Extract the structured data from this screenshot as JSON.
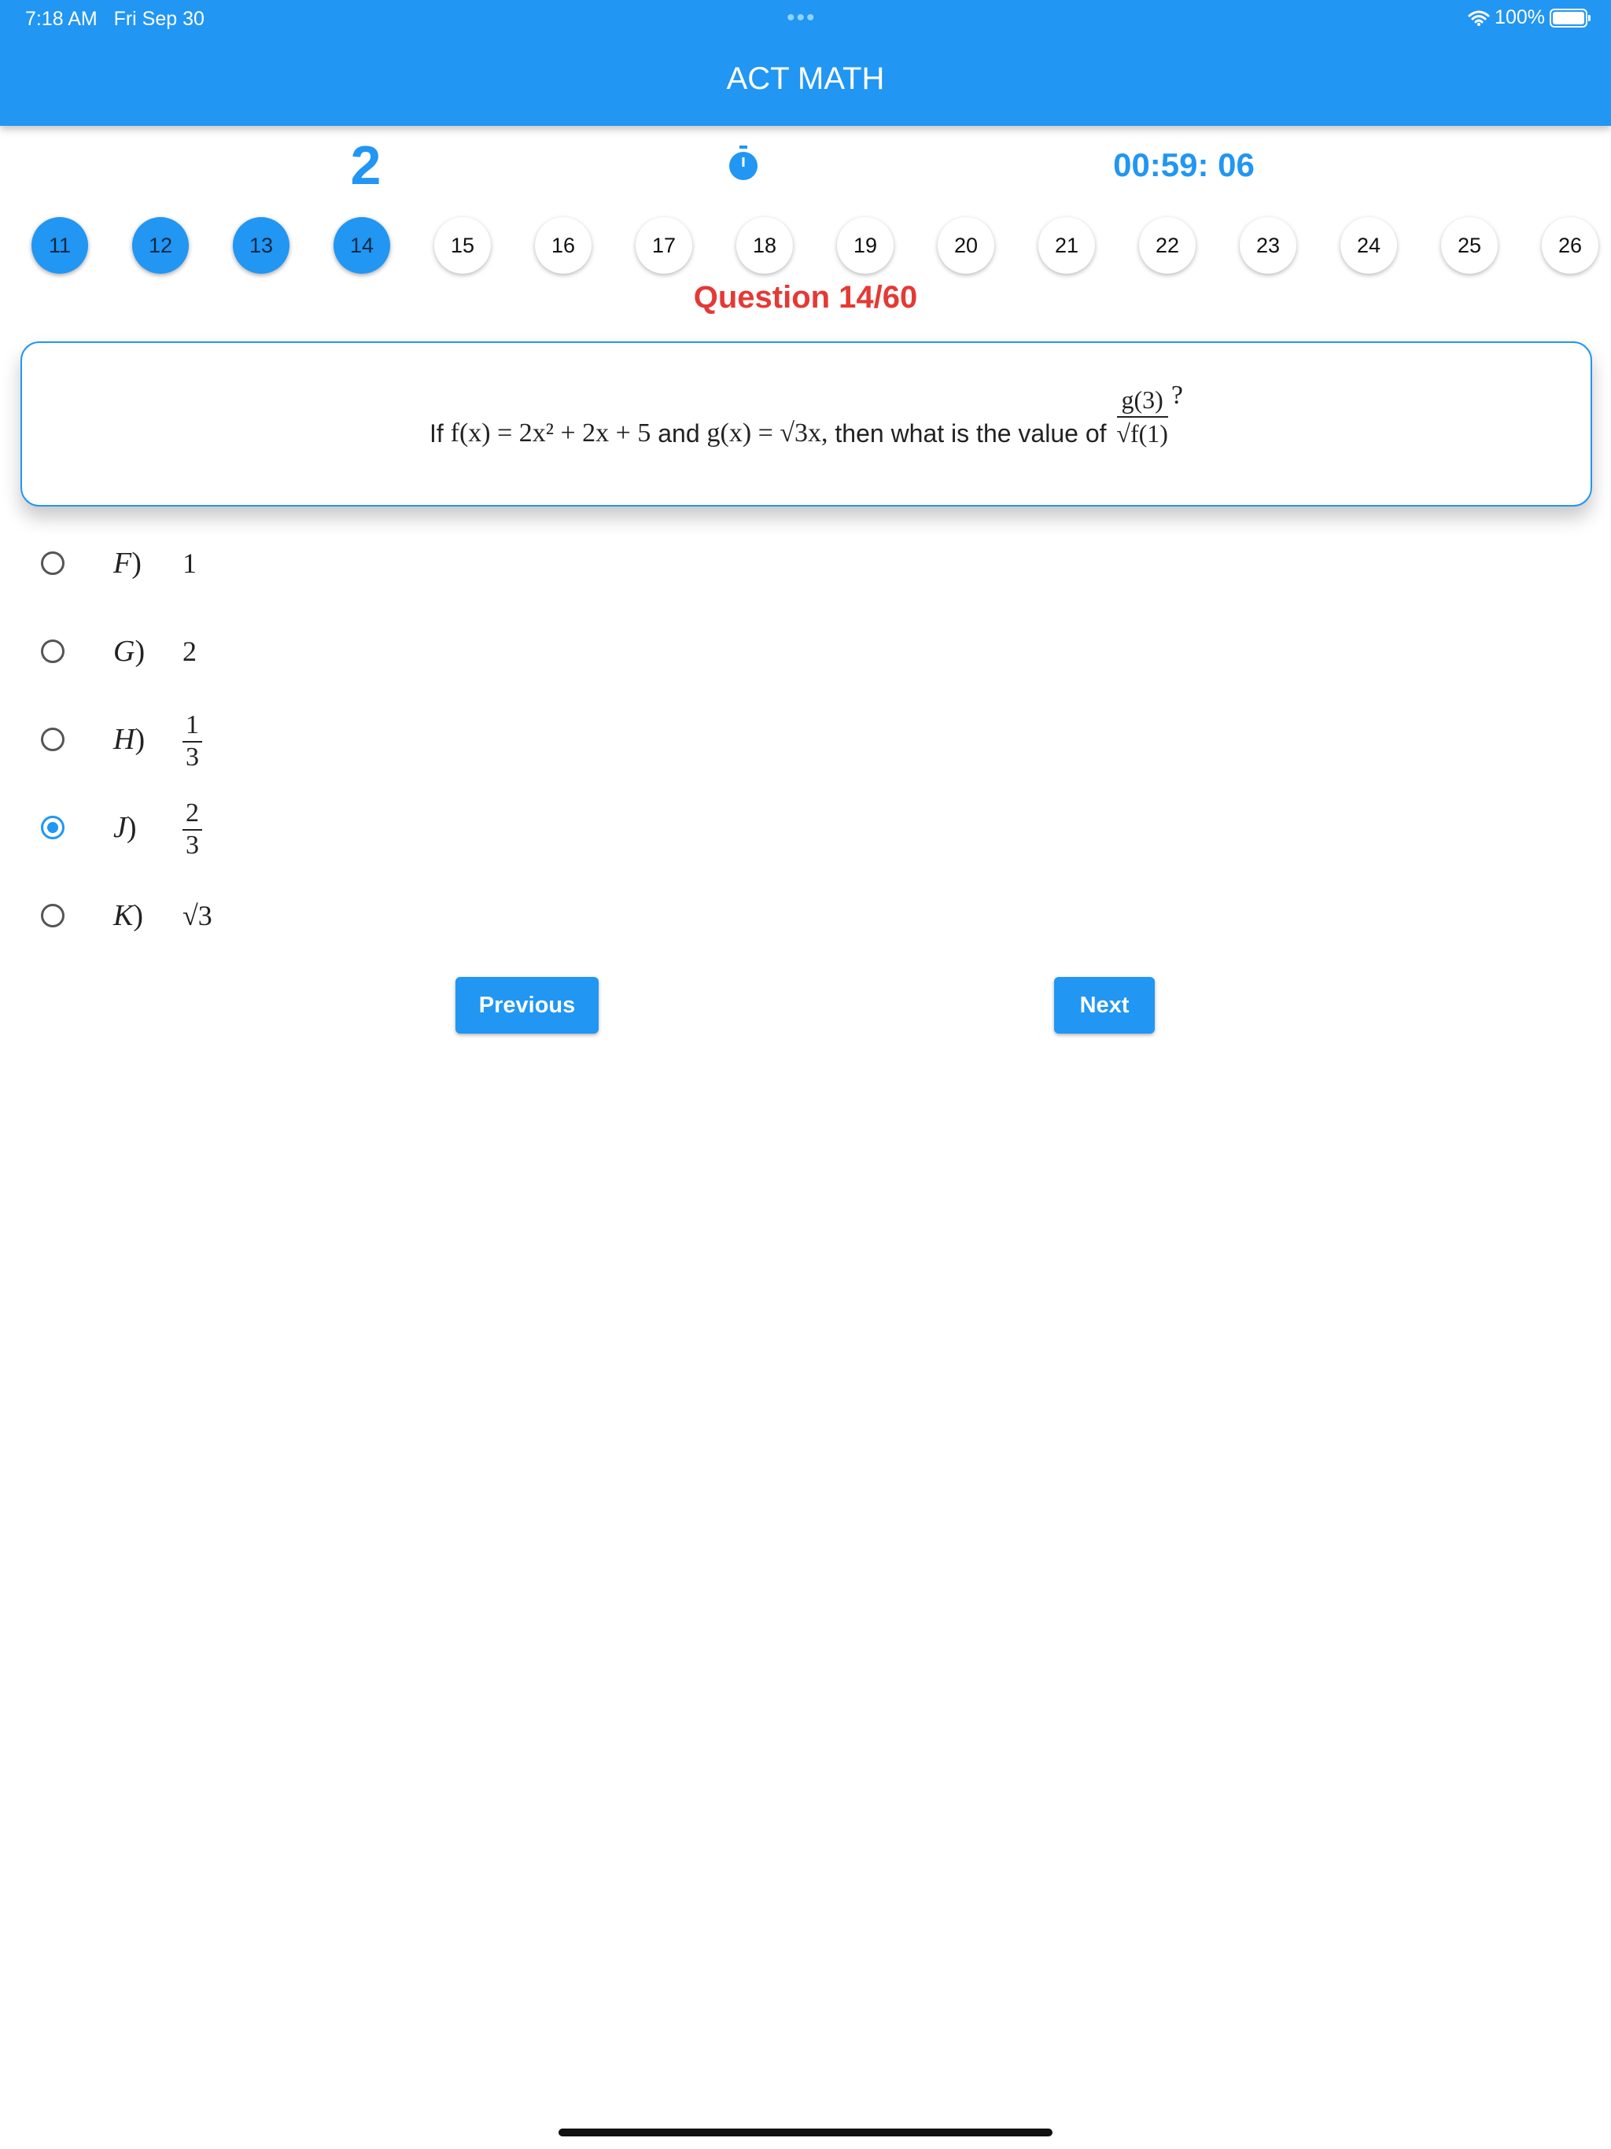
{
  "status": {
    "time": "7:18 AM",
    "date": "Fri Sep 30",
    "battery": "100%"
  },
  "app": {
    "title": "ACT MATH"
  },
  "summary": {
    "answered_count": "2",
    "timer": "00:59: 06"
  },
  "question_nav": {
    "items": [
      "11",
      "12",
      "13",
      "14",
      "15",
      "16",
      "17",
      "18",
      "19",
      "20",
      "21",
      "22",
      "23",
      "24",
      "25",
      "26"
    ],
    "answered": [
      "11",
      "12",
      "13",
      "14"
    ]
  },
  "question": {
    "label": "Question 14/60",
    "text_if": "If",
    "f_def": "f(x) = 2x² + 2x + 5",
    "text_and": "and",
    "g_def": "g(x) = √3x,",
    "text_then": "then what is the value of",
    "frac_num": "g(3)",
    "frac_den": "√f(1)",
    "qmark": "?"
  },
  "options": [
    {
      "letter": "F",
      "value": "1"
    },
    {
      "letter": "G",
      "value": "2"
    },
    {
      "letter": "H",
      "num": "1",
      "den": "3"
    },
    {
      "letter": "J",
      "num": "2",
      "den": "3",
      "selected": true
    },
    {
      "letter": "K",
      "value": "√3"
    }
  ],
  "buttons": {
    "previous": "Previous",
    "next": "Next"
  },
  "colors": {
    "primary": "#2196F3",
    "accent_red": "#E53935"
  }
}
